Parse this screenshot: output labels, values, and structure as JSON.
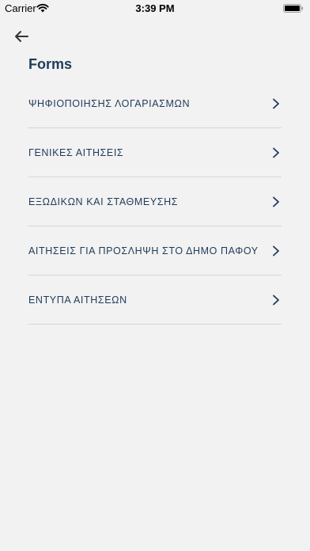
{
  "status_bar": {
    "carrier": "Carrier",
    "time": "3:39 PM"
  },
  "header": {
    "title": "Forms"
  },
  "menu": {
    "items": [
      {
        "label": "ΨΗΦΙΟΠΟΙΗΣΗΣ ΛΟΓΑΡΙΑΣΜΩΝ"
      },
      {
        "label": "ΓΕΝΙΚΕΣ ΑΙΤΗΣΕΙΣ"
      },
      {
        "label": "ΕΞΩΔΙΚΩΝ ΚΑΙ ΣΤΑΘΜΕΥΣΗΣ"
      },
      {
        "label": "ΑΙΤΗΣΕΙΣ ΓΙΑ ΠΡΟΣΛΗΨΗ ΣΤΟ ΔΗΜΟ ΠΑΦΟΥ"
      },
      {
        "label": "ΕΝΤΥΠΑ ΑΙΤΗΣΕΩΝ"
      }
    ]
  },
  "colors": {
    "background": "#f2f2f2",
    "text": "#1f3b5a",
    "divider": "#d6d6d6"
  },
  "icons": {
    "back": "arrow-left-icon",
    "chevron": "chevron-right-icon",
    "wifi": "wifi-icon",
    "battery": "battery-icon"
  }
}
